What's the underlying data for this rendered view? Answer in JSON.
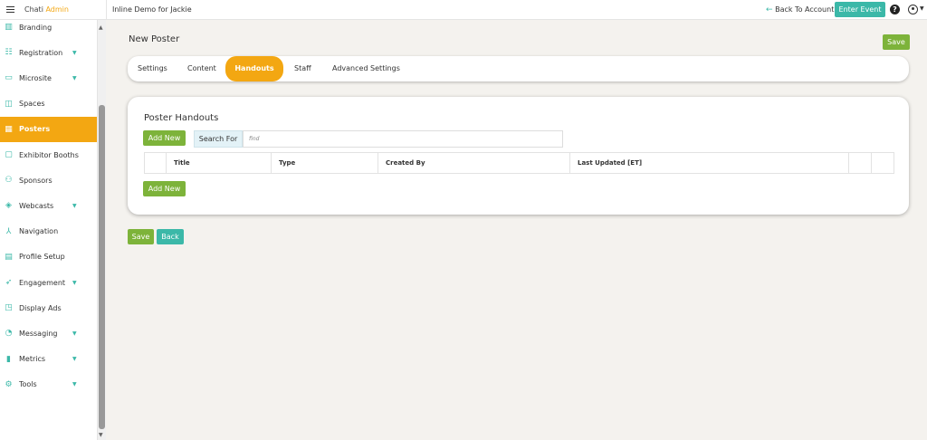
{
  "header": {
    "brand_name": "Chati",
    "brand_accent": "Admin",
    "event_title": "Inline Demo for Jackie",
    "back_label": "Back To Account",
    "enter_event_label": "Enter Event",
    "help_glyph": "?"
  },
  "sidebar": {
    "items": [
      {
        "label": "Branding",
        "icon": "branding-icon",
        "glyph": "▥",
        "has_caret": false,
        "active": false
      },
      {
        "label": "Registration",
        "icon": "registration-icon",
        "glyph": "☷",
        "has_caret": true,
        "active": false
      },
      {
        "label": "Microsite",
        "icon": "microsite-icon",
        "glyph": "▭",
        "has_caret": true,
        "active": false
      },
      {
        "label": "Spaces",
        "icon": "spaces-icon",
        "glyph": "◫",
        "has_caret": false,
        "active": false
      },
      {
        "label": "Posters",
        "icon": "posters-icon",
        "glyph": "▦",
        "has_caret": false,
        "active": true
      },
      {
        "label": "Exhibitor Booths",
        "icon": "exhibitor-booths-icon",
        "glyph": "▢",
        "has_caret": false,
        "active": false
      },
      {
        "label": "Sponsors",
        "icon": "sponsors-icon",
        "glyph": "⚇",
        "has_caret": false,
        "active": false
      },
      {
        "label": "Webcasts",
        "icon": "webcasts-icon",
        "glyph": "◈",
        "has_caret": true,
        "active": false
      },
      {
        "label": "Navigation",
        "icon": "navigation-icon",
        "glyph": "⅄",
        "has_caret": false,
        "active": false
      },
      {
        "label": "Profile Setup",
        "icon": "profile-setup-icon",
        "glyph": "▤",
        "has_caret": false,
        "active": false
      },
      {
        "label": "Engagement",
        "icon": "engagement-icon",
        "glyph": "➶",
        "has_caret": true,
        "active": false
      },
      {
        "label": "Display Ads",
        "icon": "display-ads-icon",
        "glyph": "◳",
        "has_caret": false,
        "active": false
      },
      {
        "label": "Messaging",
        "icon": "messaging-icon",
        "glyph": "◔",
        "has_caret": true,
        "active": false
      },
      {
        "label": "Metrics",
        "icon": "metrics-icon",
        "glyph": "▮",
        "has_caret": true,
        "active": false
      },
      {
        "label": "Tools",
        "icon": "tools-icon",
        "glyph": "⚙",
        "has_caret": true,
        "active": false
      }
    ]
  },
  "main": {
    "page_title": "New Poster",
    "save_label": "Save",
    "back_label": "Back",
    "tabs": [
      {
        "label": "Settings",
        "active": false
      },
      {
        "label": "Content",
        "active": false
      },
      {
        "label": "Handouts",
        "active": true
      },
      {
        "label": "Staff",
        "active": false
      },
      {
        "label": "Advanced Settings",
        "active": false
      }
    ],
    "handouts": {
      "title": "Poster Handouts",
      "add_new_label": "Add New",
      "search_label": "Search For",
      "search_value": "find",
      "columns": [
        "Title",
        "Type",
        "Created By",
        "Last Updated [ET]"
      ],
      "rows": []
    }
  },
  "colors": {
    "accent_orange": "#f3a712",
    "teal": "#3bb8a8",
    "green": "#7db33a",
    "background": "#f4f2ee"
  }
}
